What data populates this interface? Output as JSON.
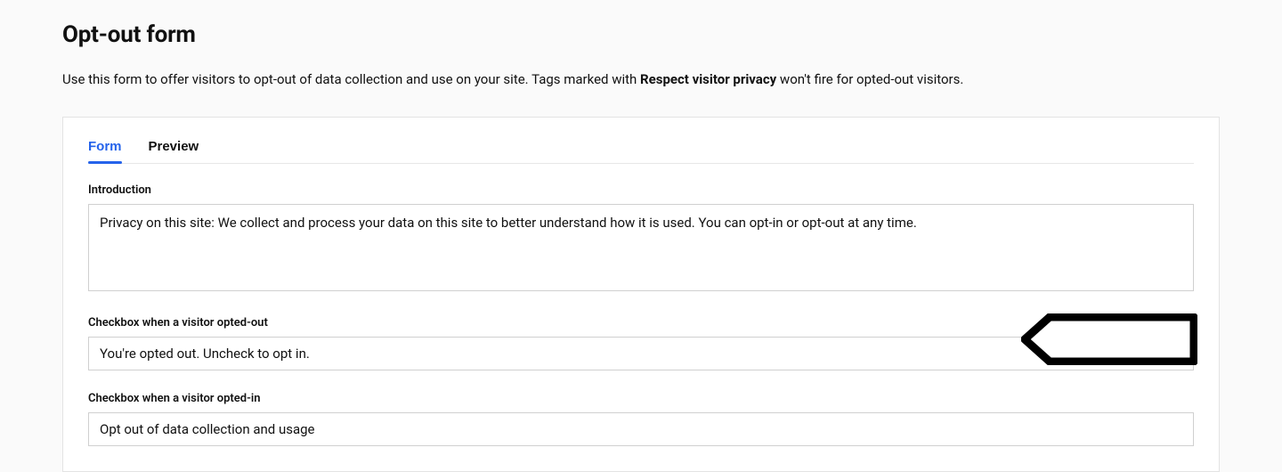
{
  "page": {
    "title": "Opt-out form",
    "desc_before": "Use this form to offer visitors to opt-out of data collection and use on your site. Tags marked with ",
    "desc_strong": "Respect visitor privacy",
    "desc_after": " won't fire for opted-out visitors."
  },
  "tabs": {
    "form": "Form",
    "preview": "Preview"
  },
  "fields": {
    "introduction": {
      "label": "Introduction",
      "value": "Privacy on this site: We collect and process your data on this site to better understand how it is used. You can opt-in or opt-out at any time."
    },
    "opted_out": {
      "label": "Checkbox when a visitor opted-out",
      "value": "You're opted out. Uncheck to opt in."
    },
    "opted_in": {
      "label": "Checkbox when a visitor opted-in",
      "value": "Opt out of data collection and usage"
    }
  }
}
